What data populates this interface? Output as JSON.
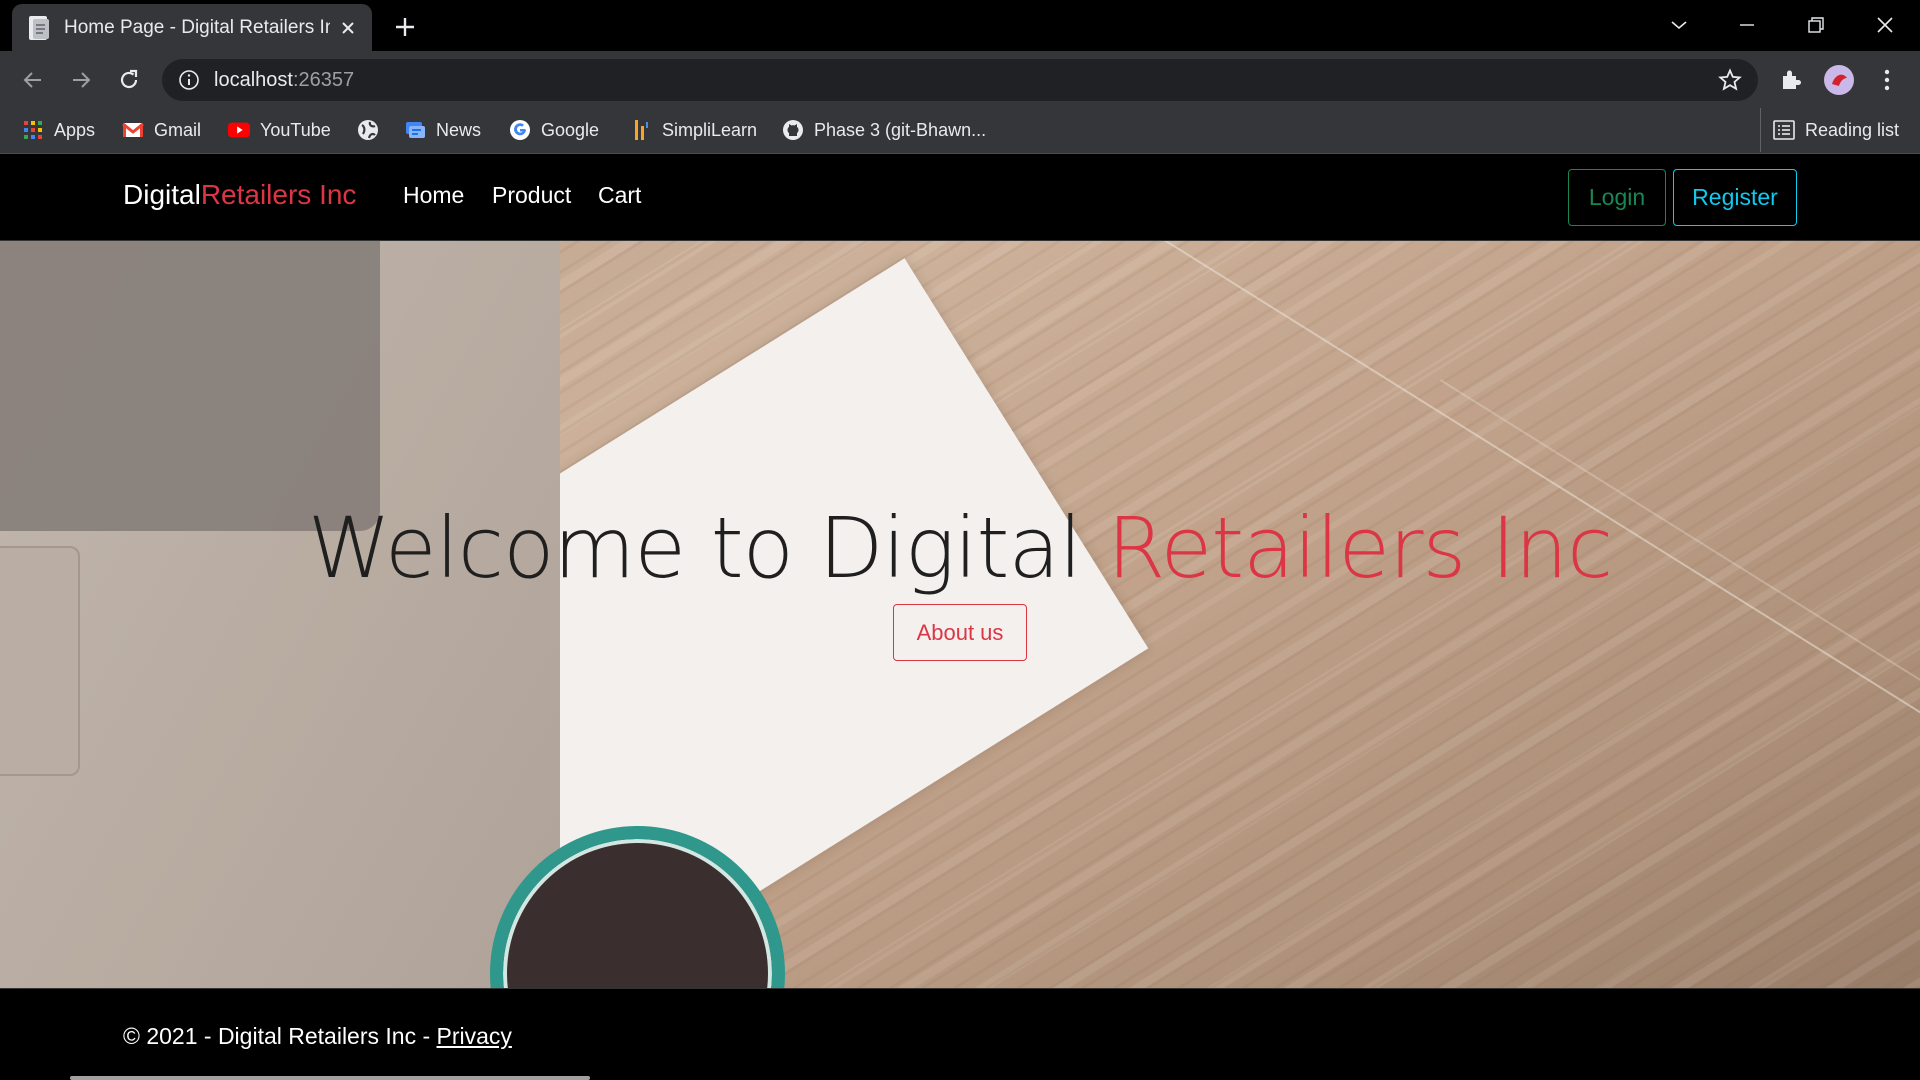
{
  "browser": {
    "tab_title": "Home Page - Digital Retailers Inc",
    "address_host": "localhost",
    "address_port": ":26357",
    "bookmarks": [
      {
        "label": "Apps",
        "icon": "apps-grid-icon"
      },
      {
        "label": "Gmail",
        "icon": "gmail-icon"
      },
      {
        "label": "YouTube",
        "icon": "youtube-icon"
      },
      {
        "label": "",
        "icon": "globe-icon"
      },
      {
        "label": "News",
        "icon": "news-icon"
      },
      {
        "label": "Google",
        "icon": "google-icon"
      },
      {
        "label": "SimpliLearn",
        "icon": "simplilearn-icon"
      },
      {
        "label": "Phase 3 (git-Bhawn...",
        "icon": "github-icon"
      }
    ],
    "reading_list": "Reading list"
  },
  "site": {
    "brand_part1": "Digital",
    "brand_part2": "Retailers Inc",
    "nav": [
      "Home",
      "Product",
      "Cart"
    ],
    "login": "Login",
    "register": "Register",
    "colors": {
      "accent": "#dc3545",
      "success": "#198754",
      "info": "#0dcaf0"
    }
  },
  "hero": {
    "title_part1": "Welcome to Digital ",
    "title_part2": "Retailers Inc",
    "about_button": "About us"
  },
  "footer": {
    "text": "© 2021 - Digital Retailers Inc - ",
    "privacy": "Privacy"
  }
}
